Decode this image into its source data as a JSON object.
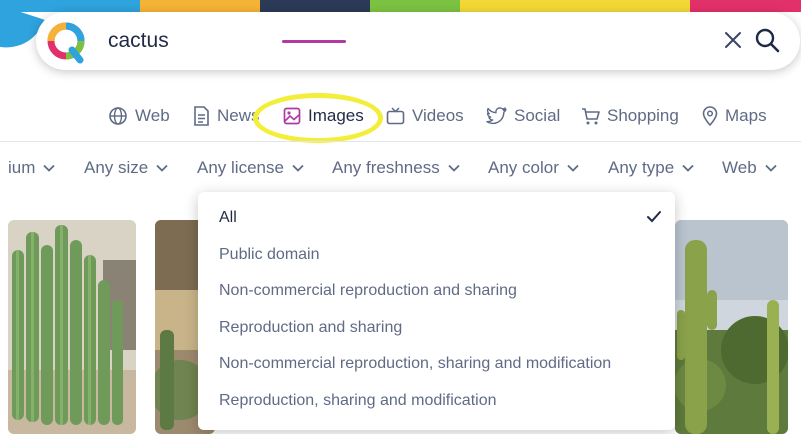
{
  "colors": {
    "accent": "#b03aa4",
    "highlight": "#f2ee3a",
    "text_dark": "#1f2a44",
    "text_muted": "#5f6b85"
  },
  "search": {
    "query": "cactus",
    "clear_icon": "close-icon",
    "submit_icon": "search-icon"
  },
  "tabs": [
    {
      "label": "Web",
      "icon": "globe-icon"
    },
    {
      "label": "News",
      "icon": "document-icon"
    },
    {
      "label": "Images",
      "icon": "image-icon",
      "active": true
    },
    {
      "label": "Videos",
      "icon": "tv-icon"
    },
    {
      "label": "Social",
      "icon": "twitter-icon"
    },
    {
      "label": "Shopping",
      "icon": "cart-icon"
    },
    {
      "label": "Maps",
      "icon": "map-pin-icon"
    }
  ],
  "filters": [
    {
      "label": "ium"
    },
    {
      "label": "Any size"
    },
    {
      "label": "Any license"
    },
    {
      "label": "Any freshness"
    },
    {
      "label": "Any color"
    },
    {
      "label": "Any type"
    },
    {
      "label": "Web"
    }
  ],
  "license_menu": {
    "selected": "All",
    "options": [
      "All",
      "Public domain",
      "Non-commercial reproduction and sharing",
      "Reproduction and sharing",
      "Non-commercial reproduction, sharing and modification",
      "Reproduction, sharing and modification"
    ]
  },
  "results": [
    {
      "subject": "cactus-photo"
    },
    {
      "subject": "cactus-photo"
    },
    {
      "subject": "cactus-photo"
    }
  ]
}
